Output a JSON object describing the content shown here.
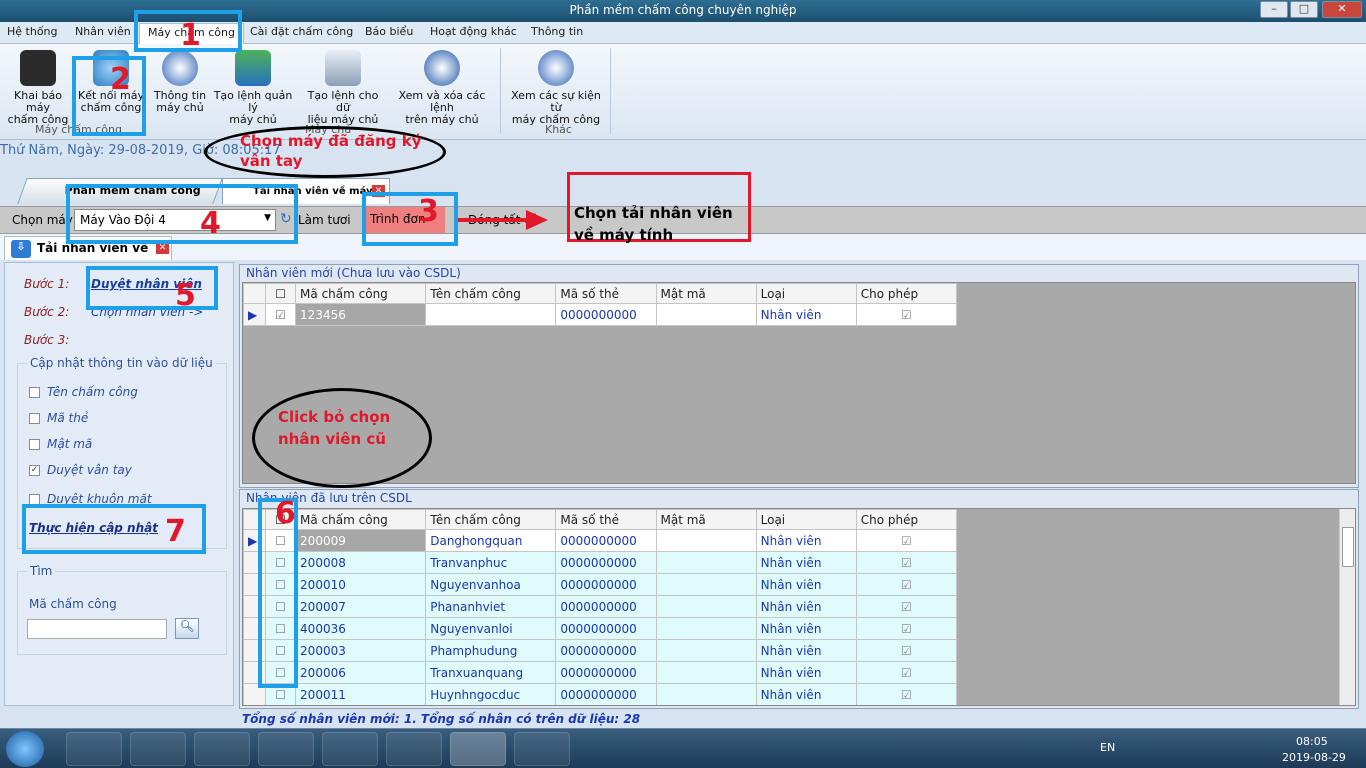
{
  "window": {
    "title": "Phần mềm chấm công chuyên nghiệp"
  },
  "menu": [
    "Hệ thống",
    "Nhân viên",
    "Máy chấm công",
    "Cài đặt chấm công",
    "Báo biểu",
    "Hoạt động khác",
    "Thông tin"
  ],
  "ribbon": {
    "buttons": [
      {
        "label1": "Khai báo máy",
        "label2": "chấm công"
      },
      {
        "label1": "Kết nối máy",
        "label2": "chấm công"
      },
      {
        "label1": "Thông tin",
        "label2": "máy chủ"
      },
      {
        "label1": "Tạo lệnh quản lý",
        "label2": "máy chủ"
      },
      {
        "label1": "Tạo lệnh cho dữ",
        "label2": "liệu máy chủ"
      },
      {
        "label1": "Xem và xóa các lệnh",
        "label2": "trên máy chủ"
      },
      {
        "label1": "Xem các sự kiện từ",
        "label2": "máy chấm công"
      }
    ],
    "groups": [
      "Máy chấm công",
      "Máy chủ",
      "Khác"
    ]
  },
  "dateline": "Thứ Năm, Ngày: 29-08-2019, Giờ: 08:05:17",
  "doctabs": [
    "Phần mềm chấm công P...",
    "Tải nhân viên về máy chấm công"
  ],
  "toolbar": {
    "choose_label": "Chọn máy",
    "machine": "Máy Vào Đội 4",
    "refresh": "Làm tươi",
    "menu": "Trình đơn",
    "close_all": "Đóng tất cả"
  },
  "subtab": "Tải nhân viên về ...",
  "left": {
    "step1": "Bước 1:",
    "step1_link": "Duyệt nhân viên",
    "step2": "Bước 2:",
    "step2_link": "Chọn nhân viên ->",
    "step3": "Bước 3:",
    "update_title": "Cập nhật thông tin vào dữ liệu",
    "options": [
      {
        "label": "Tên chấm công",
        "checked": false
      },
      {
        "label": "Mã thẻ",
        "checked": false
      },
      {
        "label": "Mật mã",
        "checked": false
      },
      {
        "label": "Duyệt vân tay",
        "checked": true
      },
      {
        "label": "Duyệt khuôn mặt",
        "checked": false
      }
    ],
    "execute": "Thực hiện cập nhật",
    "search_title": "Tìm",
    "search_label": "Mã chấm công"
  },
  "grid1": {
    "title": "Nhân viên mới (Chưa lưu vào CSDL)",
    "columns": [
      "Mã chấm công",
      "Tên chấm công",
      "Mã số thẻ",
      "Mật mã",
      "Loại",
      "Cho phép"
    ],
    "rows": [
      {
        "code": "123456",
        "name": "",
        "card": "0000000000",
        "pwd": "",
        "type": "Nhân viên"
      }
    ]
  },
  "grid2": {
    "title": "Nhân viên đã lưu trên CSDL",
    "columns": [
      "Mã chấm công",
      "Tên chấm công",
      "Mã số thẻ",
      "Mật mã",
      "Loại",
      "Cho phép"
    ],
    "rows": [
      {
        "code": "200009",
        "name": "Danghongquan",
        "card": "0000000000",
        "type": "Nhân viên"
      },
      {
        "code": "200008",
        "name": "Tranvanphuc",
        "card": "0000000000",
        "type": "Nhân viên"
      },
      {
        "code": "200010",
        "name": "Nguyenvanhoa",
        "card": "0000000000",
        "type": "Nhân viên"
      },
      {
        "code": "200007",
        "name": "Phananhviet",
        "card": "0000000000",
        "type": "Nhân viên"
      },
      {
        "code": "400036",
        "name": "Nguyenvanloi",
        "card": "0000000000",
        "type": "Nhân viên"
      },
      {
        "code": "200003",
        "name": "Phamphudung",
        "card": "0000000000",
        "type": "Nhân viên"
      },
      {
        "code": "200006",
        "name": "Tranxuanquang",
        "card": "0000000000",
        "type": "Nhân viên"
      },
      {
        "code": "200011",
        "name": "Huynhngocduc",
        "card": "0000000000",
        "type": "Nhân viên"
      }
    ]
  },
  "footer": "Tổng số nhân viên mới: 1.   Tổng số nhân có trên dữ liệu: 28",
  "annotations": {
    "n1": "1",
    "n2": "2",
    "n3": "3",
    "n4": "4",
    "n5": "5",
    "n6": "6",
    "n7": "7",
    "bubble1_l1": "Chọn máy đã đăng ký",
    "bubble1_l2": "vân tay",
    "box3_l1": "Chọn tải nhân viên",
    "box3_l2": "về máy tính",
    "bubble2_l1": "Click bỏ chọn",
    "bubble2_l2": "nhân viên cũ"
  },
  "taskbar": {
    "lang": "EN",
    "time": "08:05",
    "date": "2019-08-29"
  }
}
